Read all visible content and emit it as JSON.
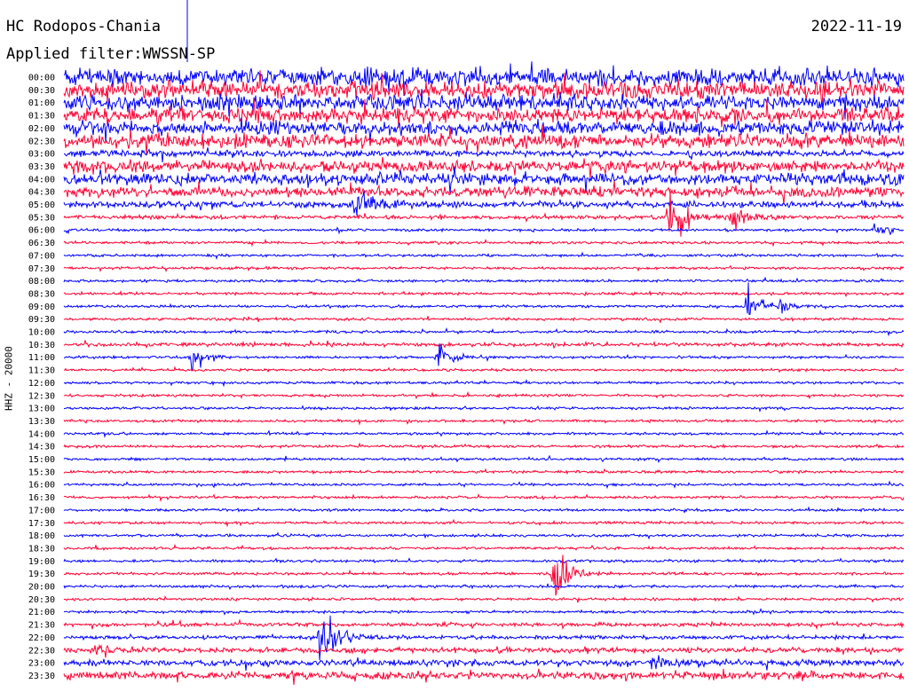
{
  "header": {
    "station": "HC Rodopos-Chania",
    "date": "2022-11-19",
    "filter": "Applied filter:WWSSN-SP"
  },
  "colors": {
    "trace_a": "#0000ff",
    "trace_b": "#ff0033",
    "background": "#ffffff",
    "text": "#000000"
  },
  "chart_data": {
    "type": "line",
    "title": "HC Rodopos-Chania",
    "ylabel": "HHZ - 20000",
    "grid": false,
    "y_tick_labels": [
      "00:00",
      "00:30",
      "01:00",
      "01:30",
      "02:00",
      "02:30",
      "03:00",
      "03:30",
      "04:00",
      "04:30",
      "05:00",
      "05:30",
      "06:00",
      "06:30",
      "07:00",
      "07:30",
      "08:00",
      "08:30",
      "09:00",
      "09:30",
      "10:00",
      "10:30",
      "11:00",
      "11:30",
      "12:00",
      "12:30",
      "13:00",
      "13:30",
      "14:00",
      "14:30",
      "15:00",
      "15:30",
      "16:00",
      "16:30",
      "17:00",
      "17:30",
      "18:00",
      "18:30",
      "19:00",
      "19:30",
      "20:00",
      "20:30",
      "21:00",
      "21:30",
      "22:00",
      "22:30",
      "23:00",
      "23:30"
    ],
    "trace_colors": [
      "#0000ff",
      "#ff0033"
    ],
    "row_noise": [
      14,
      14,
      12,
      12,
      11,
      11,
      5,
      9,
      9,
      8,
      5,
      3,
      2,
      2,
      2,
      2,
      2,
      2,
      2,
      2,
      2,
      3,
      2,
      2,
      2,
      2,
      2,
      2,
      2,
      2,
      2,
      2,
      2,
      2,
      2,
      2,
      2,
      2,
      2,
      2,
      2,
      2,
      2,
      3,
      3,
      4,
      5,
      6
    ],
    "events": [
      {
        "row": 10,
        "time_min": 10.4,
        "amplitude": 28
      },
      {
        "row": 11,
        "time_min": 21.6,
        "amplitude": 45
      },
      {
        "row": 11,
        "time_min": 23.9,
        "amplitude": 22
      },
      {
        "row": 12,
        "time_min": 29.0,
        "amplitude": 14
      },
      {
        "row": 18,
        "time_min": 24.4,
        "amplitude": 26
      },
      {
        "row": 18,
        "time_min": 25.6,
        "amplitude": 16
      },
      {
        "row": 22,
        "time_min": 4.6,
        "amplitude": 24
      },
      {
        "row": 22,
        "time_min": 13.4,
        "amplitude": 22
      },
      {
        "row": 39,
        "time_min": 17.5,
        "amplitude": 50
      },
      {
        "row": 44,
        "time_min": 9.2,
        "amplitude": 48
      },
      {
        "row": 45,
        "time_min": 1.1,
        "amplitude": 10
      },
      {
        "row": 46,
        "time_min": 21.0,
        "amplitude": 9
      }
    ]
  }
}
